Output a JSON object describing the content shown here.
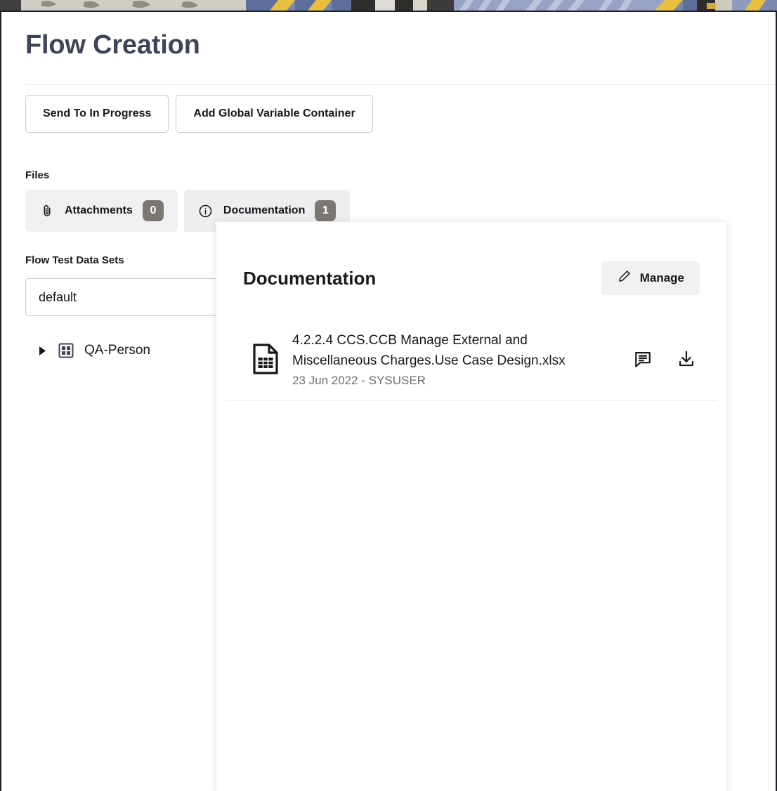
{
  "page": {
    "title": "Flow Creation"
  },
  "actions": [
    {
      "label": "Send To In Progress",
      "name": "send-to-in-progress-button"
    },
    {
      "label": "Add Global Variable Container",
      "name": "add-global-variable-container-button"
    }
  ],
  "files_section": {
    "label": "Files",
    "tabs": [
      {
        "label": "Attachments",
        "badge": "0",
        "icon": "paperclip-icon",
        "active": false
      },
      {
        "label": "Documentation",
        "badge": "1",
        "icon": "info-circle-icon",
        "active": true
      }
    ]
  },
  "flow_test_data_sets": {
    "label": "Flow Test Data Sets",
    "value": "default",
    "placeholder": "default",
    "tree": [
      {
        "label": "QA-Person",
        "icon": "grid-icon",
        "expanded": false
      }
    ]
  },
  "documentation_panel": {
    "title": "Documentation",
    "manage_label": "Manage",
    "manage_icon": "pencil-icon",
    "items": [
      {
        "name": "4.2.2.4 CCS.CCB Manage External and Miscellaneous Charges.Use Case Design.xlsx",
        "meta": "23 Jun 2022 - SYSUSER",
        "file_icon": "spreadsheet-file-icon",
        "comment_icon": "comment-icon",
        "download_icon": "download-icon"
      }
    ]
  },
  "colors": {
    "title": "#3f4458",
    "badge_bg": "#7d7772",
    "tab_bg": "#eeeeee",
    "manage_bg": "#f1f1f1",
    "border": "#c9cccf",
    "meta_text": "#6d6d6d"
  }
}
